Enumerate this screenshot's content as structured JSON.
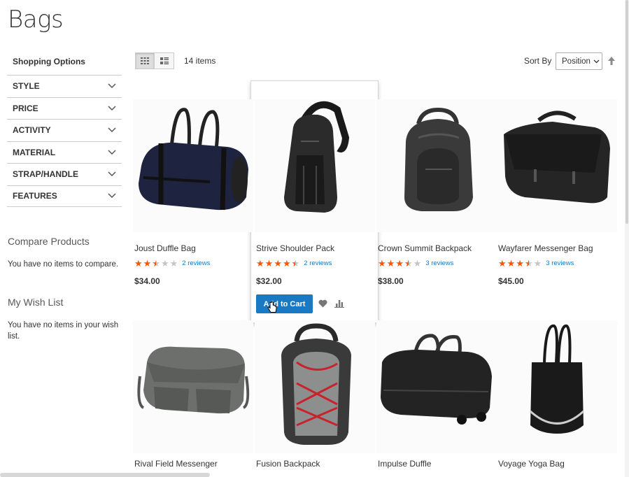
{
  "page": {
    "title": "Bags"
  },
  "sidebar": {
    "heading": "Shopping Options",
    "filters": [
      {
        "label": "STYLE"
      },
      {
        "label": "PRICE"
      },
      {
        "label": "ACTIVITY"
      },
      {
        "label": "MATERIAL"
      },
      {
        "label": "STRAP/HANDLE"
      },
      {
        "label": "FEATURES"
      }
    ],
    "compare": {
      "title": "Compare Products",
      "empty": "You have no items to compare."
    },
    "wishlist": {
      "title": "My Wish List",
      "empty": "You have no items in your wish list."
    }
  },
  "toolbar": {
    "view_modes": [
      "grid",
      "list"
    ],
    "items_count": "14 items",
    "sort_label": "Sort By",
    "sort_value": "Position"
  },
  "products": [
    {
      "name": "Joust Duffle Bag",
      "rating": 2.5,
      "reviews": "2 reviews",
      "price": "$34.00"
    },
    {
      "name": "Strive Shoulder Pack",
      "rating": 4.5,
      "reviews": "2 reviews",
      "price": "$32.00",
      "action": "Add to Cart"
    },
    {
      "name": "Crown Summit Backpack",
      "rating": 3.5,
      "reviews": "3 reviews",
      "price": "$38.00"
    },
    {
      "name": "Wayfarer Messenger Bag",
      "rating": 3.5,
      "reviews": "3 reviews",
      "price": "$45.00"
    },
    {
      "name": "Rival Field Messenger"
    },
    {
      "name": "Fusion Backpack"
    },
    {
      "name": "Impulse Duffle"
    },
    {
      "name": "Voyage Yoga Bag"
    }
  ],
  "colors": {
    "accent": "#1979c3",
    "star": "#ff5501",
    "star_empty": "#c5c5c5"
  }
}
